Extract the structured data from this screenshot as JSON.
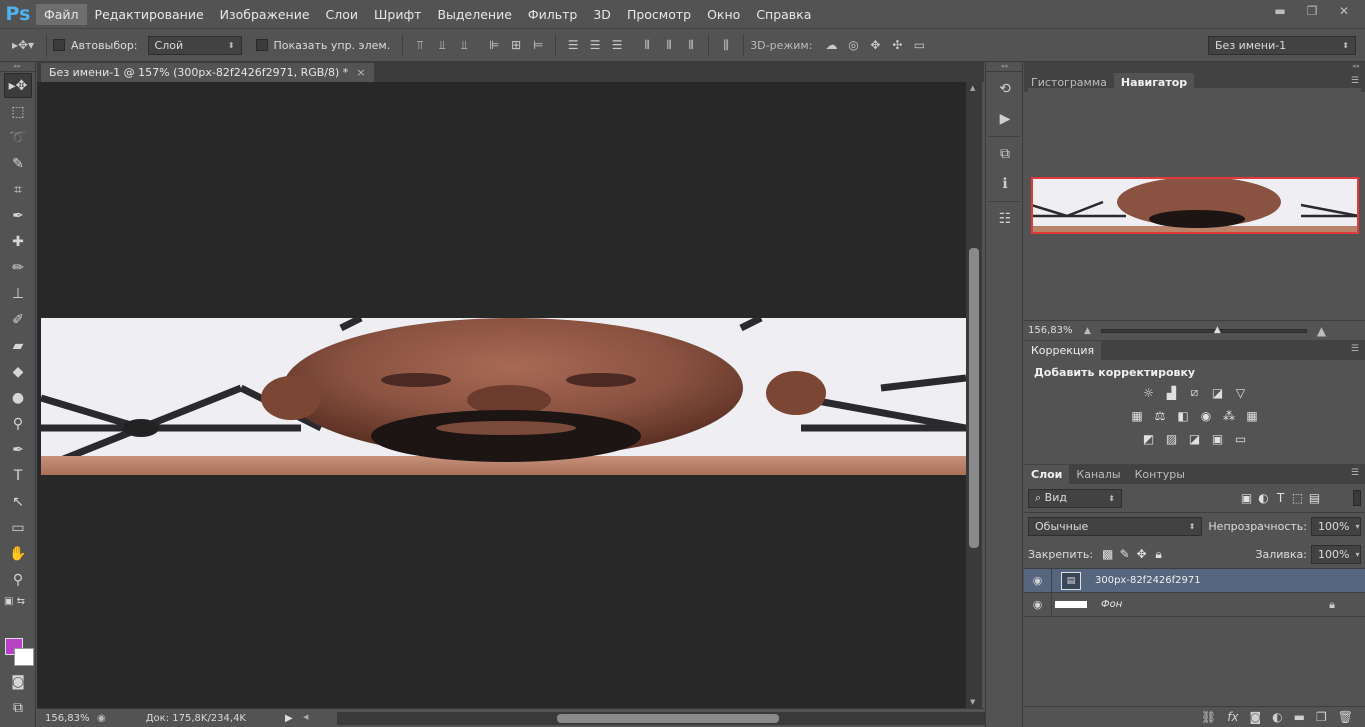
{
  "app": {
    "logo": "Ps"
  },
  "menu": [
    "Файл",
    "Редактирование",
    "Изображение",
    "Слои",
    "Шрифт",
    "Выделение",
    "Фильтр",
    "3D",
    "Просмотр",
    "Окно",
    "Справка"
  ],
  "window_controls": {
    "minimize": "▬",
    "restore": "❐",
    "close": "✕"
  },
  "options": {
    "autoselect_label": "Автовыбор:",
    "autoselect_value": "Слой",
    "show_transform_label": "Показать упр. элем.",
    "mode3d_label": "3D-режим:",
    "workspace_value": "Без имени-1"
  },
  "document": {
    "tab_title": "Без имени-1 @ 157% (300px-82f2426f2971, RGB/8) *",
    "close": "×"
  },
  "status": {
    "zoom": "156,83%",
    "doc_info": "Док: 175,8K/234,4K"
  },
  "navigator": {
    "tabs": [
      "Гистограмма",
      "Навигатор"
    ],
    "active_tab": 1,
    "zoom": "156,83%"
  },
  "adjustments": {
    "tab": "Коррекция",
    "heading": "Добавить корректировку"
  },
  "layers": {
    "tabs": [
      "Слои",
      "Каналы",
      "Контуры"
    ],
    "filter_value": "Вид",
    "blend_mode": "Обычные",
    "opacity_label": "Непрозрачность:",
    "opacity_value": "100%",
    "lock_label": "Закрепить:",
    "fill_label": "Заливка:",
    "fill_value": "100%",
    "items": [
      {
        "name": "300px-82f2426f2971"
      },
      {
        "name": "Фон"
      }
    ]
  },
  "colors": {
    "foreground": "#b643c6",
    "background": "#ffffff",
    "ps_blue": "#4fb2f3",
    "selected_layer": "#55667e"
  }
}
